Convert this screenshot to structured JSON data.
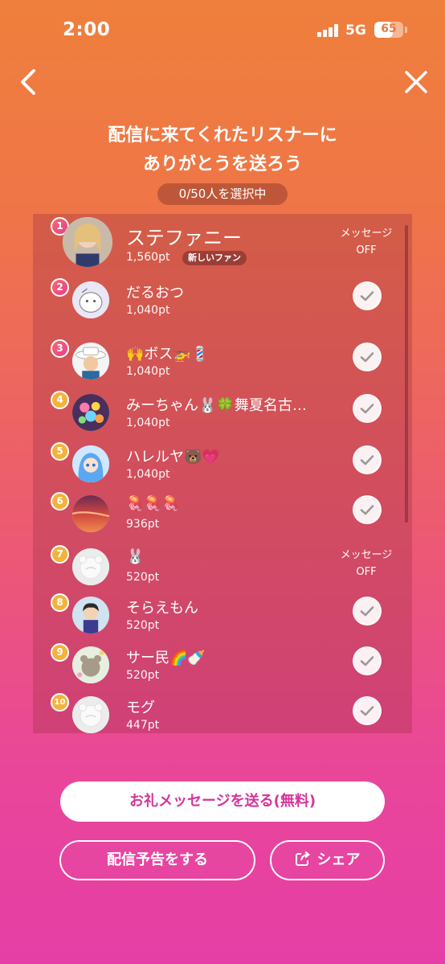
{
  "status_bar": {
    "time": "2:00",
    "network": "5G",
    "battery": "65",
    "battery_level": 0.65
  },
  "header": {
    "title_line1": "配信に来てくれたリスナーに",
    "title_line2": "ありがとうを送ろう",
    "selection_counter": "0/50人を選択中"
  },
  "listeners": [
    {
      "rank": "1",
      "name": "ステファニー",
      "points": "1,560pt",
      "badge": "新しいファン",
      "message_status": "メッセージ\nOFF",
      "avatar": "avatar-woman-blonde"
    },
    {
      "rank": "2",
      "name": "だるおつ",
      "points": "1,040pt",
      "avatar": "avatar-daruma-sketch"
    },
    {
      "rank": "3",
      "name": "🙌ボス🚁💈",
      "points": "1,040pt",
      "avatar": "avatar-man-white-hat"
    },
    {
      "rank": "4",
      "name": "みーちゃん🐰🍀舞夏名古屋…",
      "points": "1,040pt",
      "avatar": "avatar-colorful-candy"
    },
    {
      "rank": "5",
      "name": "ハレルヤ🐻💗",
      "points": "1,040pt",
      "avatar": "avatar-anime-blue"
    },
    {
      "rank": "6",
      "name": "🪼🪼🪼",
      "points": "936pt",
      "avatar": "avatar-sunset-sky"
    },
    {
      "rank": "7",
      "name": "🐰",
      "points": "520pt",
      "message_status": "メッセージ\nOFF",
      "avatar": "avatar-default-bear"
    },
    {
      "rank": "8",
      "name": "そらえもん",
      "points": "520pt",
      "avatar": "avatar-chibi-character"
    },
    {
      "rank": "9",
      "name": "サー民🌈🍼",
      "points": "520pt",
      "avatar": "avatar-flower-bear"
    },
    {
      "rank": "10",
      "name": " モグ",
      "points": "447pt",
      "avatar": "avatar-default-bear"
    }
  ],
  "actions": {
    "send_thanks": "お礼メッセージを送る(無料)",
    "announce": "配信予告をする",
    "share": "シェア"
  },
  "colors": {
    "accent_pink": "#d5349b",
    "rank_gold": "#f2b33d",
    "check_gray": "#9a9a9a"
  },
  "icons": [
    "back-icon",
    "close-icon",
    "check-icon",
    "share-icon",
    "signal-icon",
    "battery-icon"
  ]
}
